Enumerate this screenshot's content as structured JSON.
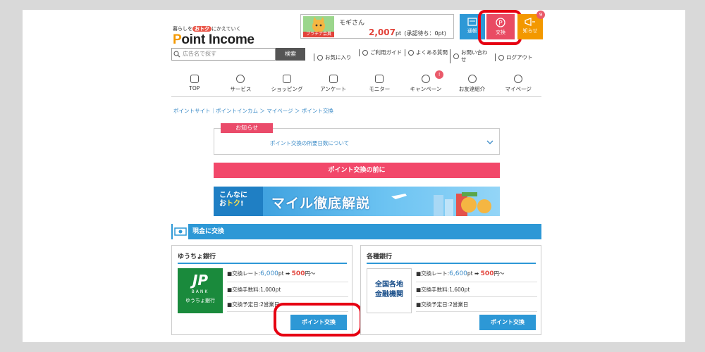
{
  "logo": {
    "tagline_pre": "暮らしを",
    "tagline_hl": "おトク",
    "tagline_post": "にかえていく",
    "name_p": "P",
    "name_rest": "oint Income"
  },
  "user": {
    "rank": "ブラチナ会員",
    "name": "モギさん",
    "points": "2,007",
    "points_unit": "pt",
    "pending": "(承認待ち：0pt)"
  },
  "topbar": {
    "notice_label": "通帳",
    "exchange_label": "交換",
    "news_label": "知らせ",
    "news_badge": "9"
  },
  "search": {
    "placeholder": "広告名で探す",
    "button": "検索"
  },
  "utility": [
    "お気に入り",
    "ご利用ガイド",
    "よくある質問",
    "お問い合わせ",
    "ログアウト"
  ],
  "nav": [
    {
      "label": "TOP"
    },
    {
      "label": "サービス"
    },
    {
      "label": "ショッピング"
    },
    {
      "label": "アンケート"
    },
    {
      "label": "モニター"
    },
    {
      "label": "キャンペーン",
      "badge": "!"
    },
    {
      "label": "お友達紹介"
    },
    {
      "label": "マイページ"
    }
  ],
  "breadcrumb": "ポイントサイト｜ポイントインカム ＞ マイページ ＞ ポイント交換",
  "notice": {
    "tag": "お知らせ",
    "link": "ポイント交換の所要日数について"
  },
  "before_bar": "ポイント交換の前に",
  "banner": {
    "line1": "こんなに",
    "line2_pre": "お",
    "line2_hl": "トク",
    "line2_post": "!",
    "title": "マイル徹底解説"
  },
  "section_title": "現金に交換",
  "cards": [
    {
      "title": "ゆうちょ銀行",
      "logo_top": "JP",
      "logo_mid": "BANK",
      "logo_bottom": "ゆうちょ銀行",
      "rate_label": "■交換レート:",
      "rate_from": "6,000",
      "rate_from_unit": "pt",
      "arrow": "➡",
      "rate_to": "500",
      "rate_to_unit": "円～",
      "fee": "■交換手数料:1,000pt",
      "schedule": "■交換予定日:2営業日",
      "button": "ポイント交換"
    },
    {
      "title": "各種銀行",
      "logo_text": "全国各地\n金融機関",
      "rate_label": "■交換レート:",
      "rate_from": "6,600",
      "rate_from_unit": "pt",
      "arrow": "➡",
      "rate_to": "500",
      "rate_to_unit": "円～",
      "fee": "■交換手数料:1,600pt",
      "schedule": "■交換予定日:2営業日",
      "button": "ポイント交換"
    }
  ],
  "colors": {
    "accent_blue": "#2d98d6",
    "accent_pink": "#f2486a",
    "highlight_red": "#e60012",
    "jp_green": "#1a8a3c"
  }
}
